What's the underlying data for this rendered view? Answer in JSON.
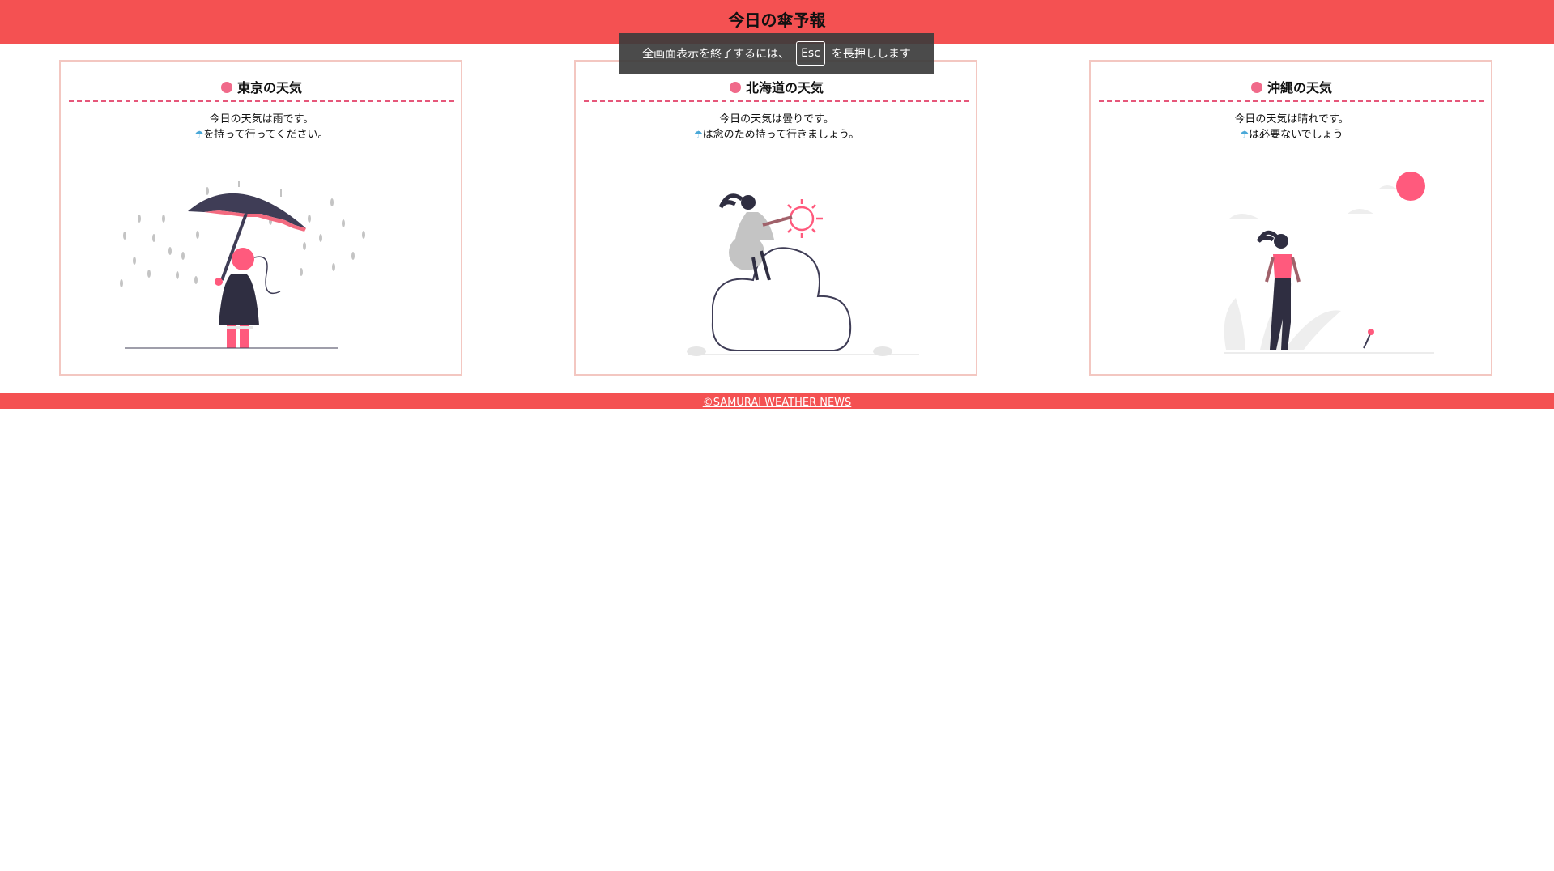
{
  "header": {
    "title": "今日の傘予報"
  },
  "fullscreen_toast": {
    "before_key": "全画面表示を終了するには、",
    "key": "Esc",
    "after_key": "を長押しします"
  },
  "cards": [
    {
      "title": "東京の天気",
      "line1": "今日の天気は雨です。",
      "umbrella_glyph": "☂",
      "line2_rest": "を持って行ってください。",
      "illustration": "rain-umbrella-illustration"
    },
    {
      "title": "北海道の天気",
      "line1": "今日の天気は曇りです。",
      "umbrella_glyph": "☂",
      "line2_rest": "は念のため持って行きましょう。",
      "illustration": "cloud-sun-illustration"
    },
    {
      "title": "沖縄の天気",
      "line1": "今日の天気は晴れです。",
      "umbrella_glyph": "☂",
      "line2_rest": "は必要ないでしょう",
      "illustration": "sunny-walk-illustration"
    }
  ],
  "footer": {
    "copyright": "©SAMURAI WEATHER NEWS"
  },
  "colors": {
    "brand": "#f45152",
    "accent_pink": "#f06a8a",
    "card_border": "#f3c7c1",
    "umbrella_icon": "#4aa8d8"
  }
}
